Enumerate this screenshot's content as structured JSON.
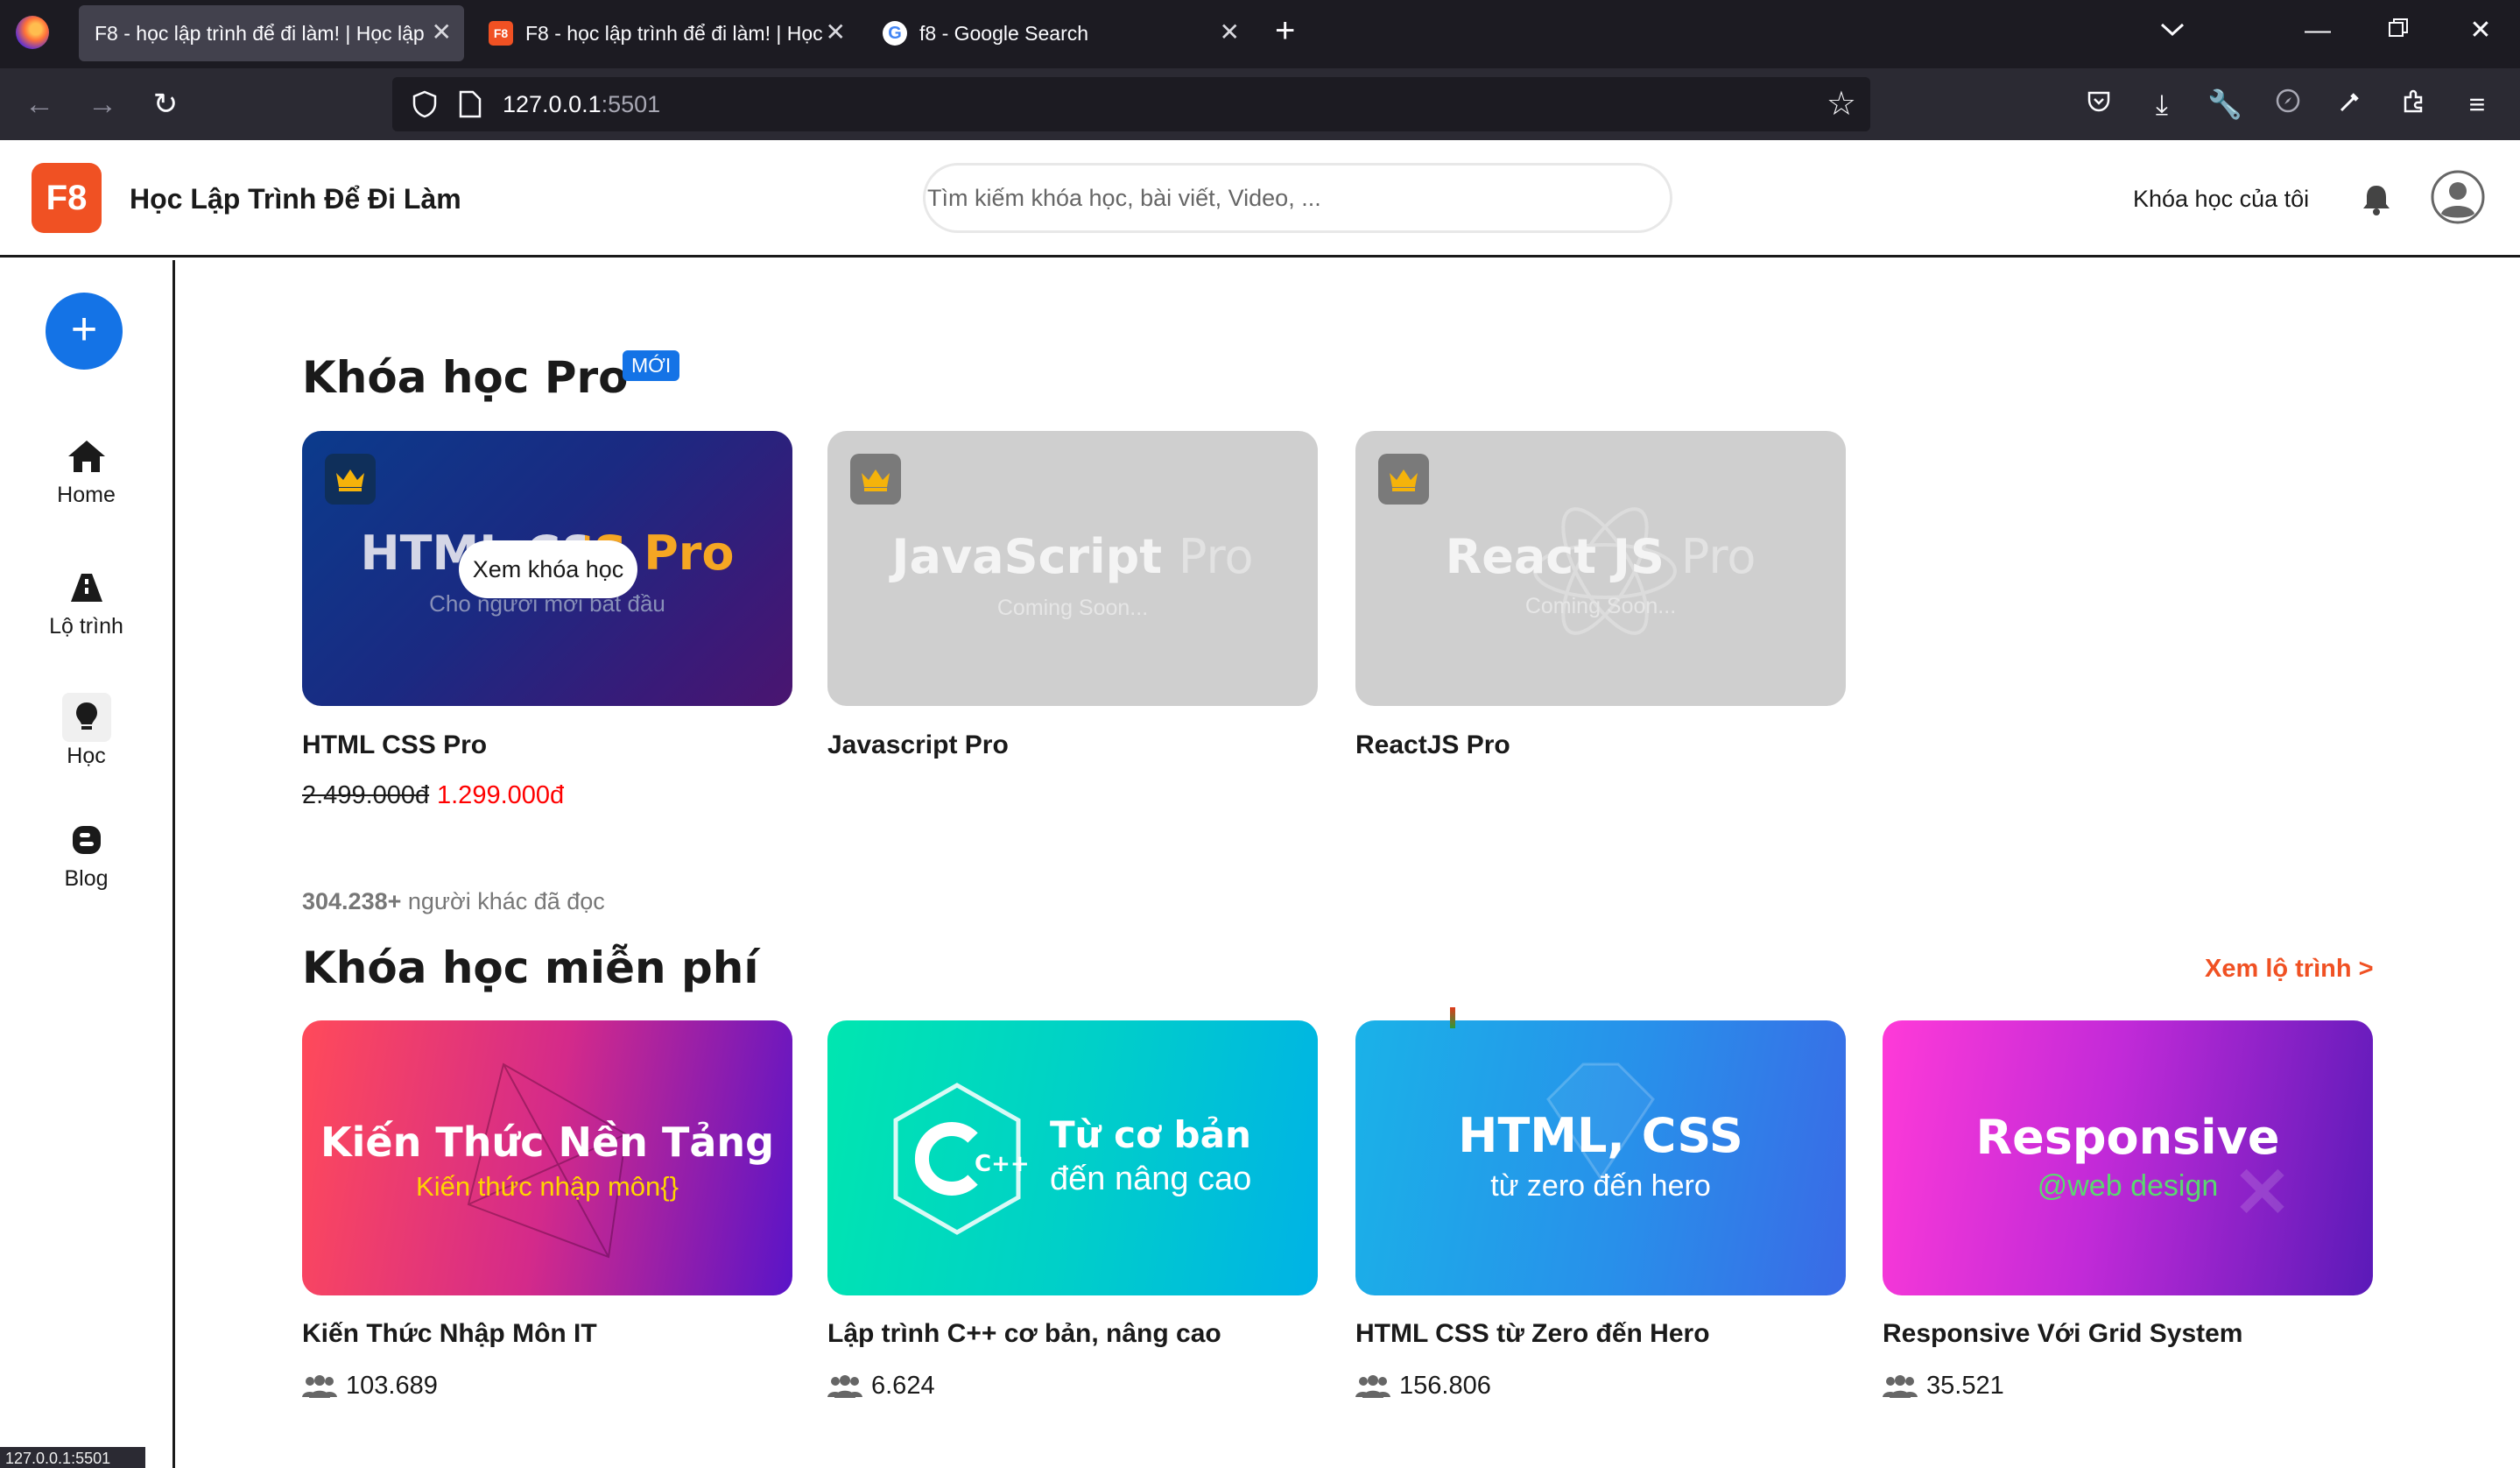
{
  "browser": {
    "tabs": [
      {
        "title": "F8 - học lập trình để đi làm! | Học lập",
        "active": true
      },
      {
        "title": "F8 - học lập trình để đi làm! | Học",
        "active": false
      },
      {
        "title": "f8 - Google Search",
        "active": false
      }
    ],
    "url_host": "127.0.0.1",
    "url_port": ":5501",
    "status_url": "127.0.0.1:5501"
  },
  "header": {
    "logo": "F8",
    "brand": "Học Lập Trình Để Đi Làm",
    "search_placeholder": "Tìm kiếm khóa học, bài viết, Video, ...",
    "my_courses": "Khóa học của tôi"
  },
  "sidebar": {
    "items": [
      {
        "label": "Home",
        "icon": "home-icon"
      },
      {
        "label": "Lộ trình",
        "icon": "road-icon"
      },
      {
        "label": "Học",
        "icon": "lightbulb-icon"
      },
      {
        "label": "Blog",
        "icon": "blog-icon"
      }
    ]
  },
  "pro": {
    "heading": "Khóa học Pro",
    "badge": "MỚI",
    "hover_button": "Xem khóa học",
    "courses": [
      {
        "name": "HTML CSS Pro",
        "banner_title": "HTML CSS Pro",
        "banner_sub": "Cho người mới bắt đầu",
        "price_old": "2.499.000đ",
        "price_new": "1.299.000đ"
      },
      {
        "name": "Javascript Pro",
        "banner_title": "JavaScript",
        "banner_pro": "Pro",
        "banner_sub": "Coming Soon..."
      },
      {
        "name": "ReactJS Pro",
        "banner_title": "React JS",
        "banner_pro": "Pro",
        "banner_sub": "Coming Soon..."
      }
    ]
  },
  "readers": {
    "count": "304.238+",
    "text": " người khác đã đọc"
  },
  "free": {
    "heading": "Khóa học miễn phí",
    "roadmap_link": "Xem lộ trình >",
    "courses": [
      {
        "name": "Kiến Thức Nhập Môn IT",
        "banner_title": "Kiến Thức Nền Tảng",
        "banner_sub": "Kiến thức nhập môn{}",
        "students": "103.689"
      },
      {
        "name": "Lập trình C++ cơ bản, nâng cao",
        "banner_title": "Từ cơ bản",
        "banner_sub": "đến nâng cao",
        "logo": "C++",
        "students": "6.624"
      },
      {
        "name": "HTML CSS từ Zero đến Hero",
        "banner_title": "HTML, CSS",
        "banner_sub": "từ zero đến hero",
        "students": "156.806"
      },
      {
        "name": "Responsive Với Grid System",
        "banner_title": "Responsive",
        "banner_sub": "@web design",
        "students": "35.521"
      }
    ]
  },
  "colors": {
    "accent": "#f05123",
    "primary": "#1473e6",
    "price": "#ff0000"
  }
}
